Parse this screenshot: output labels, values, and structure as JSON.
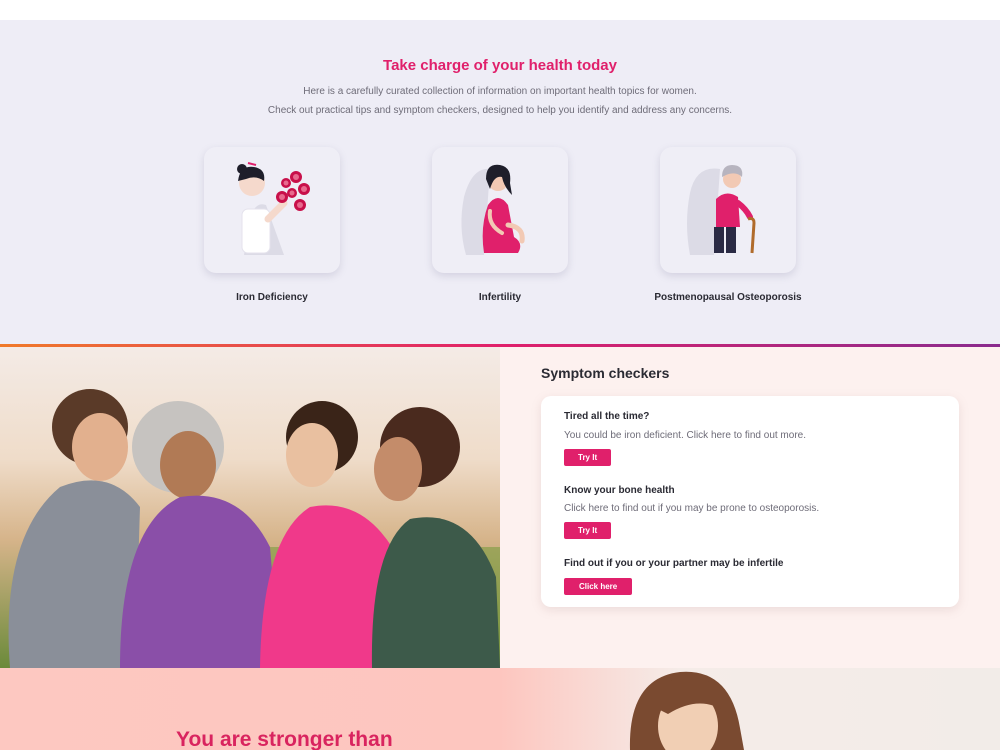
{
  "topics": {
    "title": "Take charge of your health today",
    "intro_line1": "Here is a carefully curated collection of information on important health topics for women.",
    "intro_line2": "Check out practical tips and symptom checkers, designed to help you identify and address any concerns.",
    "cards": [
      {
        "label": "Iron Deficiency",
        "icon": "iron-deficiency-illustration"
      },
      {
        "label": "Infertility",
        "icon": "pregnant-woman-illustration"
      },
      {
        "label": "Postmenopausal Osteoporosis",
        "icon": "elderly-woman-cane-illustration"
      }
    ]
  },
  "checkers": {
    "title": "Symptom checkers",
    "items": [
      {
        "title": "Tired all the time?",
        "text": "You could be iron deficient. Click here to find out more.",
        "button": "Try It"
      },
      {
        "title": "Know your bone health",
        "text": "Click here to find out if you may be prone to osteoporosis.",
        "button": "Try It"
      },
      {
        "title": "Find out if you or your partner may be infertile",
        "text": "",
        "button": "Click here"
      }
    ]
  },
  "bottom": {
    "heading": "You are stronger than"
  },
  "colors": {
    "accent": "#e0206b",
    "topics_bg": "#eeedf6",
    "checkers_bg": "#fdf1ef",
    "gradient": [
      "#f07a2a",
      "#e0206b",
      "#8a2b8e"
    ]
  }
}
